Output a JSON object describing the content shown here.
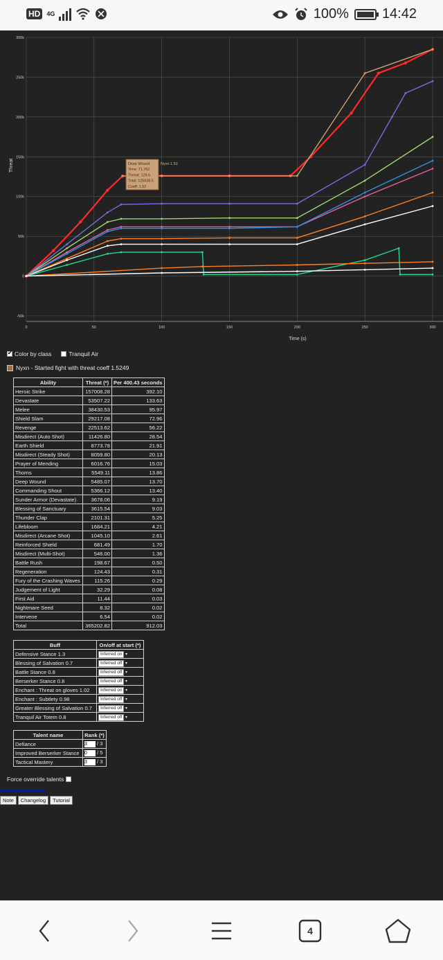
{
  "status": {
    "hd": "HD",
    "net": "4G",
    "battery": "100%",
    "time": "14:42"
  },
  "chart": {
    "ylabel": "Threat",
    "xlabel": "Time (s)",
    "y_ticks": [
      "300k",
      "250k",
      "200k",
      "150k",
      "100k",
      "50k",
      "0",
      "-50k"
    ],
    "x_ticks": [
      "0",
      "50",
      "100",
      "150",
      "200",
      "250",
      "300"
    ],
    "tooltip": {
      "lines": [
        "Deep Wound",
        "Time: 71.762",
        "Threat: 129.6",
        "Total: 125638.5",
        "Coeff: 1.52"
      ],
      "side_label": "Nyxn 1.52"
    }
  },
  "chart_data": {
    "type": "line",
    "xlabel": "Time (s)",
    "ylabel": "Threat",
    "xlim": [
      0,
      300
    ],
    "ylim": [
      -50000,
      300000
    ],
    "grid": true,
    "series": [
      {
        "name": "Nyxn",
        "color": "#ff2a2a",
        "x": [
          0,
          20,
          40,
          60,
          71,
          75,
          100,
          150,
          195,
          210,
          240,
          260,
          280,
          300
        ],
        "y": [
          0,
          32000,
          68000,
          108000,
          125638,
          126000,
          126000,
          126000,
          126000,
          150000,
          205000,
          255000,
          268000,
          285000
        ]
      },
      {
        "color": "#d0a070",
        "x": [
          71,
          100,
          150,
          195,
          200,
          250,
          300
        ],
        "y": [
          126000,
          126000,
          126000,
          126000,
          126000,
          255000,
          285000
        ]
      },
      {
        "color": "#7070e0",
        "x": [
          0,
          30,
          60,
          70,
          100,
          150,
          200,
          250,
          270,
          280,
          300
        ],
        "y": [
          0,
          40000,
          80000,
          90000,
          91000,
          91000,
          91000,
          140000,
          200000,
          230000,
          245000
        ]
      },
      {
        "color": "#a0d870",
        "x": [
          0,
          30,
          60,
          70,
          100,
          150,
          200,
          250,
          300
        ],
        "y": [
          0,
          35000,
          68000,
          72000,
          72000,
          73000,
          73000,
          120000,
          175000
        ]
      },
      {
        "color": "#e060a0",
        "x": [
          0,
          30,
          60,
          70,
          100,
          150,
          200,
          250,
          300
        ],
        "y": [
          0,
          30000,
          58000,
          62000,
          62000,
          62000,
          62000,
          100000,
          135000
        ]
      },
      {
        "color": "#3090e0",
        "x": [
          0,
          30,
          60,
          70,
          100,
          150,
          200,
          250,
          300
        ],
        "y": [
          0,
          28000,
          56000,
          60000,
          60000,
          60000,
          62000,
          105000,
          145000
        ]
      },
      {
        "color": "#ff8020",
        "x": [
          0,
          30,
          60,
          70,
          100,
          150,
          200,
          250,
          300
        ],
        "y": [
          0,
          22000,
          44000,
          47000,
          47000,
          48000,
          48000,
          75000,
          105000
        ]
      },
      {
        "color": "#ffffff",
        "x": [
          0,
          30,
          60,
          70,
          100,
          150,
          200,
          250,
          300
        ],
        "y": [
          0,
          20000,
          38000,
          40000,
          40000,
          40000,
          40000,
          65000,
          88000
        ]
      },
      {
        "color": "#20e090",
        "x": [
          0,
          30,
          60,
          70,
          100,
          130,
          131,
          200,
          250,
          275,
          276,
          300
        ],
        "y": [
          0,
          14000,
          28000,
          30000,
          30000,
          30000,
          2000,
          2000,
          20000,
          35000,
          2000,
          2000
        ]
      },
      {
        "color": "#ff8020",
        "x": [
          0,
          100,
          130,
          200,
          250,
          300
        ],
        "y": [
          0,
          10000,
          12000,
          14000,
          16000,
          18000
        ]
      },
      {
        "color": "#ffffff",
        "x": [
          0,
          100,
          200,
          250,
          300
        ],
        "y": [
          0,
          4000,
          6000,
          8000,
          10000
        ]
      }
    ]
  },
  "controls": {
    "color_by_class": "Color by class",
    "tranquil_air": "Tranquil Air",
    "fight_label": "Nyxn - Started fight with threat coeff 1.5249"
  },
  "ability_table": {
    "headers": [
      "Ability",
      "Threat (*)",
      "Per 400.43 seconds"
    ],
    "rows": [
      [
        "Heroic Strike",
        "157008.28",
        "392.10"
      ],
      [
        "Devastate",
        "53507.22",
        "133.63"
      ],
      [
        "Melee",
        "38430.53",
        "95.97"
      ],
      [
        "Shield Slam",
        "29217.08",
        "72.96"
      ],
      [
        "Revenge",
        "22513.62",
        "56.22"
      ],
      [
        "Misdirect (Auto Shot)",
        "11426.80",
        "28.54"
      ],
      [
        "Earth Shield",
        "8773.78",
        "21.91"
      ],
      [
        "Misdirect (Steady Shot)",
        "8059.80",
        "20.13"
      ],
      [
        "Prayer of Mending",
        "6016.76",
        "15.03"
      ],
      [
        "Thorns",
        "5549.11",
        "13.86"
      ],
      [
        "Deep Wound",
        "5485.07",
        "13.70"
      ],
      [
        "Commanding Shout",
        "5366.12",
        "13.40"
      ],
      [
        "Sunder Armor (Devastate)",
        "3678.06",
        "9.19"
      ],
      [
        "Blessing of Sanctuary",
        "3615.54",
        "9.03"
      ],
      [
        "Thunder Clap",
        "2101.31",
        "5.25"
      ],
      [
        "Lifebloom",
        "1684.21",
        "4.21"
      ],
      [
        "Misdirect (Arcane Shot)",
        "1045.10",
        "2.61"
      ],
      [
        "Reinforced Shield",
        "681.49",
        "1.70"
      ],
      [
        "Misdirect (Multi-Shot)",
        "546.00",
        "1.36"
      ],
      [
        "Battle Rush",
        "198.67",
        "0.50"
      ],
      [
        "Regeneration",
        "124.43",
        "0.31"
      ],
      [
        "Fury of the Crashing Waves",
        "115.26",
        "0.29"
      ],
      [
        "Judgement of Light",
        "32.29",
        "0.08"
      ],
      [
        "First Aid",
        "11.44",
        "0.03"
      ],
      [
        "Nightmare Seed",
        "8.32",
        "0.02"
      ],
      [
        "Intervene",
        "6.54",
        "0.02"
      ],
      [
        "Total",
        "365202.82",
        "912.03"
      ]
    ]
  },
  "buff_table": {
    "headers": [
      "Buff",
      "On/off at start (*)"
    ],
    "rows": [
      [
        "Defensive Stance 1.3",
        "Inferred on"
      ],
      [
        "Blessing of Salvation 0.7",
        "Inferred off"
      ],
      [
        "Battle Stance 0.8",
        "Inferred off"
      ],
      [
        "Berserker Stance 0.8",
        "Inferred off"
      ],
      [
        "Enchant : Threat on gloves 1.02",
        "Inferred on"
      ],
      [
        "Enchant : Subtlety 0.98",
        "Inferred off"
      ],
      [
        "Greater Blessing of Salvation 0.7",
        "Inferred off"
      ],
      [
        "Tranquil Air Totem 0.8",
        "Inferred off"
      ]
    ]
  },
  "talent_table": {
    "headers": [
      "Talent name",
      "Rank (*)"
    ],
    "rows": [
      [
        "Defiance",
        "3",
        "/ 3"
      ],
      [
        "Improved Berserker Stance",
        "0",
        "/ 5"
      ],
      [
        "Tactical Mastery",
        "3",
        "/ 3"
      ]
    ]
  },
  "force_override": "Force override talents",
  "buttons": [
    "Note",
    "Changelog",
    "Tutorial"
  ],
  "nav": {
    "tabs_count": "4"
  }
}
